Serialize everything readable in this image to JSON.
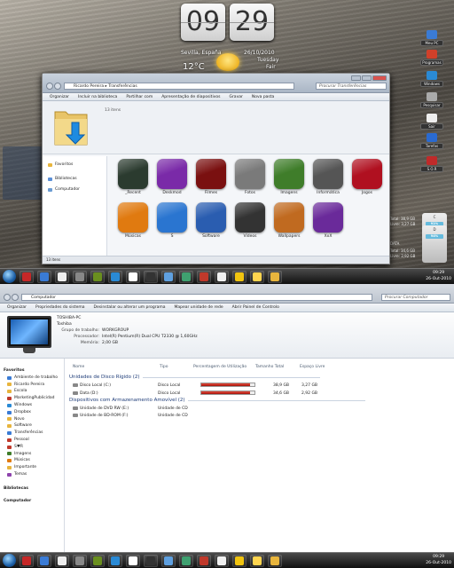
{
  "clock": {
    "hour": "09",
    "minute": "29",
    "city": "Sevilla, España",
    "date": "26/10/2010",
    "temp": "12°C",
    "day": "Tuesday",
    "extra": "Fair"
  },
  "top_explorer": {
    "addr_1": "Ricardo Pereira",
    "addr_2": "Transferências",
    "search_placeholder": "Procurar Transferências",
    "commands": [
      "Organizar",
      "Incluir na biblioteca",
      "Partilhar com",
      "Apresentação de diapositivos",
      "Gravar",
      "Nova pasta"
    ],
    "item_count": "13 itens",
    "nav": [
      {
        "label": "Favoritos",
        "color": "#e8b53d"
      },
      {
        "label": "Bibliotecas",
        "color": "#5b8fd6"
      },
      {
        "label": "Computador",
        "color": "#6a9bd2"
      }
    ],
    "icons": [
      {
        "label": "_Recent",
        "color": "#2b3b2f"
      },
      {
        "label": "Deskmod",
        "color": "#7a2aa8"
      },
      {
        "label": "Filmes",
        "color": "#7a1010"
      },
      {
        "label": "Fotos",
        "color": "#7a7a7a"
      },
      {
        "label": "Imagens",
        "color": "#3f7d2a"
      },
      {
        "label": "Informática",
        "color": "#555555"
      },
      {
        "label": "Jogos",
        "color": "#b01020"
      },
      {
        "label": "Músicas",
        "color": "#e07a10"
      },
      {
        "label": "S",
        "color": "#2a75d0"
      },
      {
        "label": "Software",
        "color": "#2a5db0"
      },
      {
        "label": "Vídeos",
        "color": "#333333"
      },
      {
        "label": "Wallpapers",
        "color": "#c06a20"
      },
      {
        "label": "XxX",
        "color": "#6a2a9a"
      }
    ],
    "status": "13 itens"
  },
  "gadgets": [
    {
      "label": "Meu PC",
      "color": "#3a7bd5"
    },
    {
      "label": "Programas",
      "color": "#d0402a"
    },
    {
      "label": "Windows",
      "color": "#2a8ad5"
    },
    {
      "label": "Pesquisar",
      "color": "#aaaaaa"
    },
    {
      "label": "Sair",
      "color": "#eeeeee"
    },
    {
      "label": "Tarefas",
      "color": "#2a6ad0"
    },
    {
      "label": "S.O.R",
      "color": "#c02a2a"
    }
  ],
  "drives": [
    {
      "letter": "C",
      "info": "Total: 38,9 GB",
      "free": "Livre: 3,27 GB",
      "pct": "91%"
    },
    {
      "letter": "D",
      "info": "Total: 34,6 GB",
      "free": "Livre: 2,92 GB",
      "pct": "94%"
    }
  ],
  "drive_caption": "DATA",
  "taskbar": {
    "time": "09:29",
    "date": "26-Out-2010",
    "icon_colors": [
      "#c62828",
      "#3a7bd5",
      "#eeeeee",
      "#888888",
      "#6a8f1f",
      "#2a8ad5",
      "#ffffff",
      "#333333",
      "#5fa0e0",
      "#3fa070",
      "#c0392b",
      "#f0f0f0",
      "#f1c40f",
      "#ffd54f",
      "#e8b53d"
    ]
  },
  "computer": {
    "search_placeholder": "Procurar Computador",
    "breadcrumb": "Computador",
    "commands": [
      "Organizar",
      "Propriedades do sistema",
      "Desinstalar ou alterar um programa",
      "Mapear unidade de rede",
      "Abrir Painel de Controlo"
    ],
    "pc_name": "TOSHIBA-PC",
    "pc_make": "Toshiba",
    "info": [
      {
        "k": "Grupo de trabalho:",
        "v": "WORKGROUP"
      },
      {
        "k": "Processador:",
        "v": "Intel(R) Pentium(R) Dual  CPU  T2330  @ 1,60GHz"
      },
      {
        "k": "Memória:",
        "v": "2,00 GB"
      }
    ],
    "nav_header": "Favoritos",
    "nav": [
      {
        "label": "Ambiente de trabalho",
        "color": "#3a7bd5"
      },
      {
        "label": "Ricardo Pereira",
        "color": "#e8b53d"
      },
      {
        "label": "Escola",
        "color": "#e8b53d"
      },
      {
        "label": "MarketingPublicidad",
        "color": "#c0392b"
      },
      {
        "label": "Windows",
        "color": "#2a8ad5"
      },
      {
        "label": "Dropbox",
        "color": "#3a7bd5"
      },
      {
        "label": "Novo",
        "color": "#e8b53d"
      },
      {
        "label": "Software",
        "color": "#e8b53d"
      },
      {
        "label": "Transferências",
        "color": "#3a7bd5"
      },
      {
        "label": "Pessoal",
        "color": "#c0392b"
      },
      {
        "label": "S♥R",
        "color": "#c0392b"
      },
      {
        "label": "Imagens",
        "color": "#3f7d2a"
      },
      {
        "label": "Músicas",
        "color": "#e07a10"
      },
      {
        "label": "Importante",
        "color": "#e8b53d"
      },
      {
        "label": "Temas",
        "color": "#8e44ad"
      }
    ],
    "nav_libraries": "Bibliotecas",
    "nav_computer": "Computador",
    "columns": [
      "Nome",
      "Tipo",
      "Percentagem de Utilização",
      "Tamanho Total",
      "Espaço Livre"
    ],
    "group_hdd": "Unidades de Disco Rígido (2)",
    "disks": [
      {
        "name": "Disco Local (C:)",
        "type": "Disco Local",
        "used": 0.91,
        "total": "38,9 GB",
        "free": "3,27 GB"
      },
      {
        "name": "Data (D:)",
        "type": "Disco Local",
        "used": 0.92,
        "total": "34,6 GB",
        "free": "2,92 GB"
      }
    ],
    "group_removable": "Dispositivos com Armazenamento Amovível (2)",
    "removables": [
      {
        "name": "Unidade de DVD RW (E:)",
        "type": "Unidade de CD"
      },
      {
        "name": "Unidade de BD-ROM (F:)",
        "type": "Unidade de CD"
      }
    ],
    "status": "4 itens",
    "status_right": "Computador"
  }
}
